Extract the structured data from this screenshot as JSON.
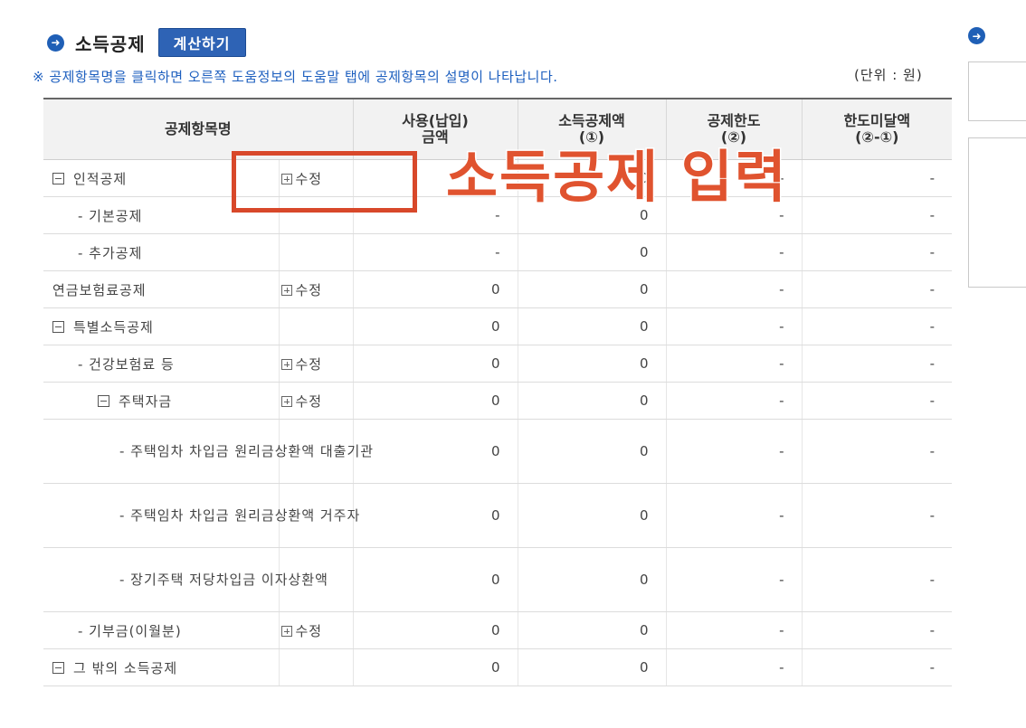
{
  "header": {
    "title": "소득공제",
    "calc_button": "계산하기",
    "notice": "※ 공제항목명을 클릭하면 오른쪽 도움정보의 도움말 탭에 공제항목의 설명이 나타납니다.",
    "unit": "(단위 : 원)"
  },
  "table": {
    "columns": {
      "name": "공제항목명",
      "paid_1": "사용(납입)",
      "paid_2": "금액",
      "deduct_1": "소득공제액",
      "deduct_2": "(①)",
      "limit_1": "공제한도",
      "limit_2": "(②)",
      "remain_1": "한도미달액",
      "remain_2": "(②-①)"
    },
    "edit_label": "수정",
    "rows": [
      {
        "label": "인적공제",
        "paid": "",
        "deduct": "0",
        "limit": "-",
        "remain": "-"
      },
      {
        "label": "- 기본공제",
        "paid": "-",
        "deduct": "0",
        "limit": "-",
        "remain": "-"
      },
      {
        "label": "- 추가공제",
        "paid": "-",
        "deduct": "0",
        "limit": "-",
        "remain": "-"
      },
      {
        "label": "연금보험료공제",
        "paid": "0",
        "deduct": "0",
        "limit": "-",
        "remain": "-"
      },
      {
        "label": "특별소득공제",
        "paid": "0",
        "deduct": "0",
        "limit": "-",
        "remain": "-"
      },
      {
        "label": "- 건강보험료 등",
        "paid": "0",
        "deduct": "0",
        "limit": "-",
        "remain": "-"
      },
      {
        "label": "주택자금",
        "paid": "0",
        "deduct": "0",
        "limit": "-",
        "remain": "-"
      },
      {
        "label": "- 주택임차 차입금 원리금상환액 대출기관",
        "paid": "0",
        "deduct": "0",
        "limit": "-",
        "remain": "-"
      },
      {
        "label": "- 주택임차 차입금 원리금상환액 거주자",
        "paid": "0",
        "deduct": "0",
        "limit": "-",
        "remain": "-"
      },
      {
        "label": "- 장기주택 저당차입금 이자상환액",
        "paid": "0",
        "deduct": "0",
        "limit": "-",
        "remain": "-"
      },
      {
        "label": "- 기부금(이월분)",
        "paid": "0",
        "deduct": "0",
        "limit": "-",
        "remain": "-"
      },
      {
        "label": "그 밖의 소득공제",
        "paid": "0",
        "deduct": "0",
        "limit": "-",
        "remain": "-"
      }
    ]
  },
  "overlay": {
    "text": "소득공제 입력",
    "color": "#e0532f"
  },
  "icons": [
    "arrow-right-circle-icon",
    "plus-square-icon",
    "minus-square-icon"
  ]
}
